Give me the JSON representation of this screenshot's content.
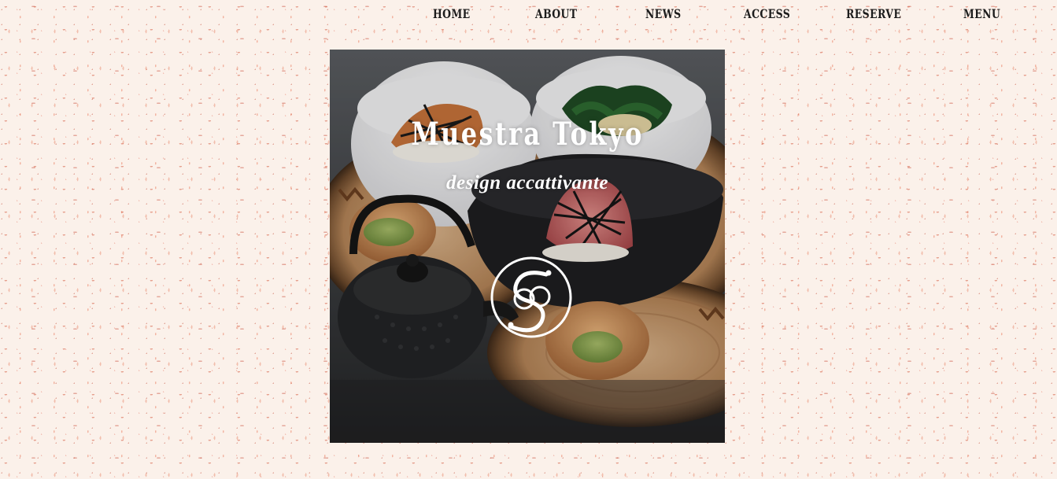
{
  "nav": {
    "items": [
      {
        "label": "HOME"
      },
      {
        "label": "ABOUT"
      },
      {
        "label": "NEWS"
      },
      {
        "label": "ACCESS"
      },
      {
        "label": "RESERVE"
      },
      {
        "label": "MENU"
      }
    ]
  },
  "hero": {
    "title": "Muestra Tokyo",
    "subtitle": "design accattivante",
    "logo_icon": "monogram-s-logo",
    "image_icon": "japanese-food-bowls-teapot-photo"
  },
  "colors": {
    "background": "#fbf1ea",
    "paper_flecks": "#d6604a",
    "nav_text": "#1c1c1c",
    "hero_text": "#ffffff"
  }
}
